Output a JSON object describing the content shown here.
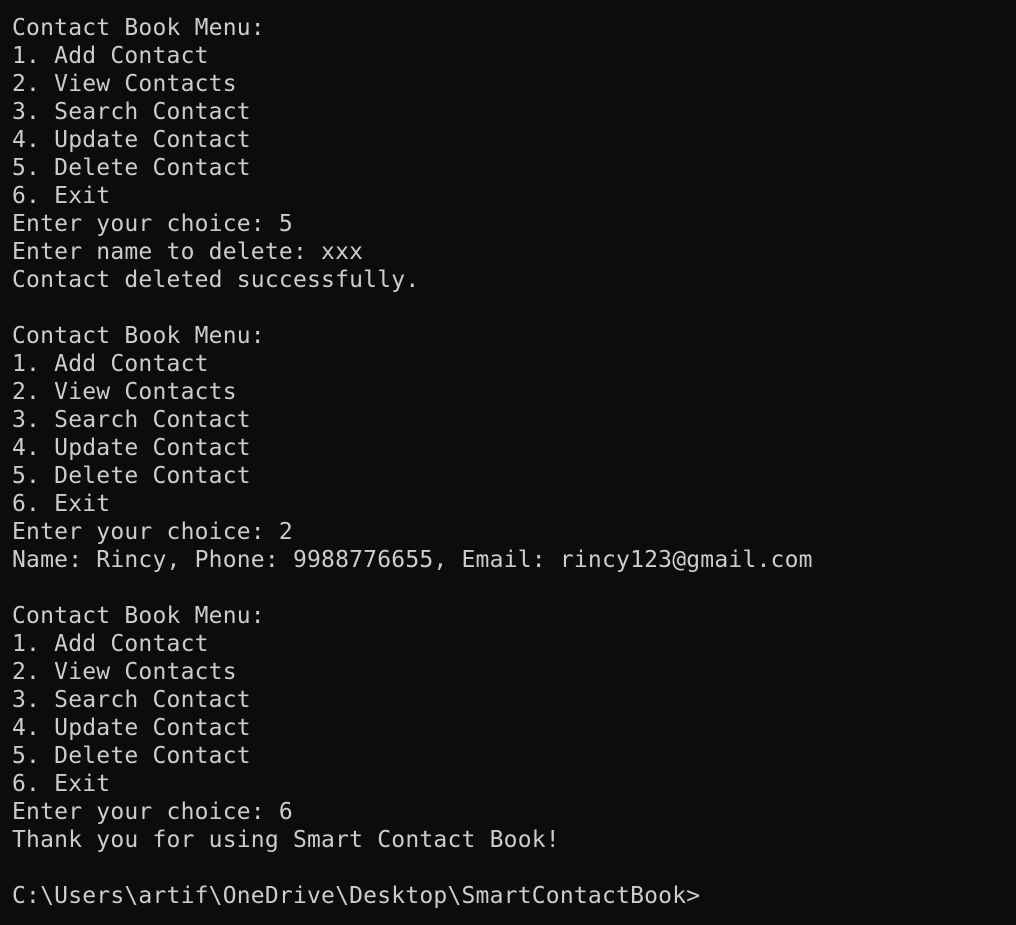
{
  "terminal": {
    "lines": [
      "Contact Book Menu:",
      "1. Add Contact",
      "2. View Contacts",
      "3. Search Contact",
      "4. Update Contact",
      "5. Delete Contact",
      "6. Exit",
      "Enter your choice: 5",
      "Enter name to delete: xxx",
      "Contact deleted successfully.",
      "",
      "Contact Book Menu:",
      "1. Add Contact",
      "2. View Contacts",
      "3. Search Contact",
      "4. Update Contact",
      "5. Delete Contact",
      "6. Exit",
      "Enter your choice: 2",
      "Name: Rincy, Phone: 9988776655, Email: rincy123@gmail.com",
      "",
      "Contact Book Menu:",
      "1. Add Contact",
      "2. View Contacts",
      "3. Search Contact",
      "4. Update Contact",
      "5. Delete Contact",
      "6. Exit",
      "Enter your choice: 6",
      "Thank you for using Smart Contact Book!",
      "",
      "C:\\Users\\artif\\OneDrive\\Desktop\\SmartContactBook>"
    ]
  },
  "colors": {
    "background": "#0c0c0c",
    "text": "#cccccc"
  }
}
